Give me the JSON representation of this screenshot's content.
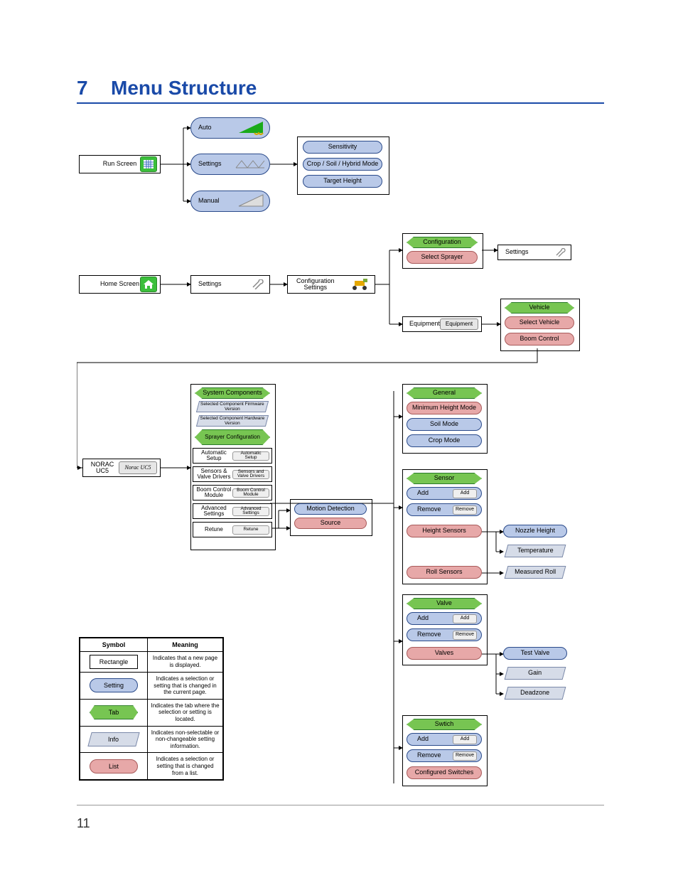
{
  "section_number": "7",
  "section_title": "Menu Structure",
  "page_number": "11",
  "flow": {
    "run_screen": "Run Screen",
    "auto": "Auto",
    "settings": "Settings",
    "manual": "Manual",
    "sensitivity": "Sensitivity",
    "crop_soil_hybrid": "Crop / Soil / Hybrid Mode",
    "target_height": "Target Height",
    "home_screen": "Home Screen",
    "config_settings": "Configuration Settings",
    "configuration_tab": "Configuration",
    "select_sprayer": "Select Sprayer",
    "settings_right": "Settings",
    "equipment": "Equipment",
    "equipment_btn": "Equipment",
    "vehicle_tab": "Vehicle",
    "select_vehicle": "Select Vehicle",
    "boom_control": "Boom Control",
    "norac": "NORAC UC5",
    "norac_btn": "Norac UC5",
    "system_components": "System Components",
    "sel_fw": "Selected Component Firmware Version",
    "sel_hw": "Selected Component Hardware Version",
    "sprayer_config": "Sprayer Configuration",
    "auto_setup": "Automatic Setup",
    "auto_setup_btn": "Automatic Setup",
    "sensors_valve": "Sensors & Valve Drivers",
    "sensors_valve_btn": "Sensors and Valve Drivers",
    "boom_ctrl_mod": "Boom Control Module",
    "boom_ctrl_mod_btn": "Boom Control Module",
    "adv_settings": "Advanced Settings",
    "adv_settings_btn": "Advanced Settings",
    "retune": "Retune",
    "retune_btn": "Retune",
    "motion_detection": "Motion Detection",
    "source": "Source",
    "general_tab": "General",
    "min_height_mode": "Minimum Height Mode",
    "soil_mode": "Soil Mode",
    "crop_mode": "Crop Mode",
    "sensor_tab": "Sensor",
    "add": "Add",
    "add_btn": "Add",
    "remove": "Remove",
    "remove_btn": "Remove",
    "height_sensors": "Height Sensors",
    "roll_sensors": "Roll Sensors",
    "nozzle_height": "Nozzle Height",
    "temperature": "Temperature",
    "measured_roll": "Measured Roll",
    "valve_tab": "Valve",
    "valves": "Valves",
    "test_valve": "Test Valve",
    "gain": "Gain",
    "deadzone": "Deadzone",
    "switch_tab": "Swtich",
    "configured_switches": "Configured Switches"
  },
  "legend": {
    "header_symbol": "Symbol",
    "header_meaning": "Meaning",
    "rectangle": "Rectangle",
    "rectangle_mean": "Indicates that a new page is displayed.",
    "setting": "Setting",
    "setting_mean": "Indicates a selection or setting that is changed in the current page.",
    "tab": "Tab",
    "tab_mean": "Indicates the tab where the selection or setting is located.",
    "info": "Info",
    "info_mean": "Indicates non-selectable or non-changeable setting information.",
    "list": "List",
    "list_mean": "Indicates a selection or setting that is changed from a list."
  }
}
